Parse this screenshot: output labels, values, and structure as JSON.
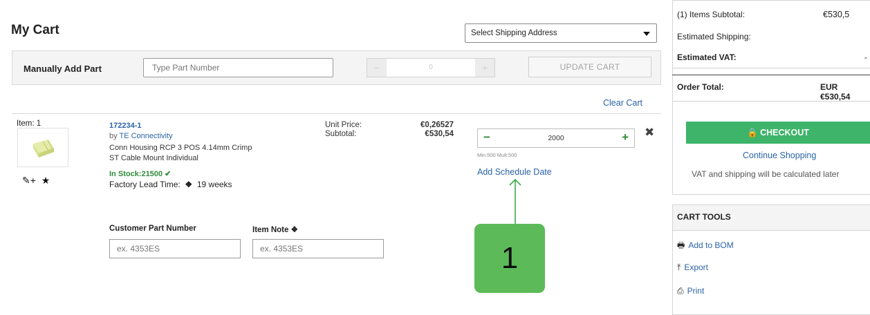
{
  "page_title": "My Cart",
  "shipping_select": {
    "value": "Select Shipping Address"
  },
  "manual_add": {
    "label": "Manually Add Part",
    "part_placeholder": "Type Part Number",
    "qty_value": "0",
    "minus": "−",
    "plus": "+",
    "update_label": "UPDATE CART"
  },
  "clear_cart": "Clear Cart",
  "item": {
    "number_label": "Item: 1",
    "part_number": "172234-1",
    "by_prefix": "by ",
    "manufacturer": "TE Connectivity",
    "description_line1": "Conn Housing RCP 3 POS 4.14mm Crimp",
    "description_line2": "ST Cable Mount Individual",
    "stock": "In Stock:21500",
    "lead_time_label": "Factory Lead Time:",
    "lead_time_value": "19 weeks",
    "unit_price_label": "Unit Price:",
    "unit_price": "€0,26527",
    "subtotal_label": "Subtotal:",
    "subtotal": "€530,54",
    "quantity": "2000",
    "min_mult": "Min:500  Mult:500",
    "schedule_link": "Add Schedule Date",
    "customer_part_label": "Customer Part Number",
    "customer_part_placeholder": "ex. 4353ES",
    "item_note_label": "Item Note",
    "item_note_placeholder": "ex. 4353ES"
  },
  "annotation_badge": "1",
  "summary": {
    "items_subtotal_label": "(1) Items Subtotal:",
    "items_subtotal_value": "€530,5",
    "est_shipping_label": "Estimated Shipping:",
    "est_vat_label": "Estimated VAT:",
    "est_vat_value": "-",
    "order_total_label": "Order Total:",
    "order_total_value": "EUR €530,54",
    "checkout_label": "CHECKOUT",
    "continue_label": "Continue Shopping",
    "vat_note": "VAT and shipping will be calculated later"
  },
  "cart_tools": {
    "title": "CART TOOLS",
    "items": [
      "Add to BOM",
      "Export",
      "Print"
    ]
  },
  "colors": {
    "link": "#2a63a8",
    "stock_green": "#2e8b3a",
    "checkout_green": "#3db46a",
    "badge_green": "#5cbb58"
  }
}
